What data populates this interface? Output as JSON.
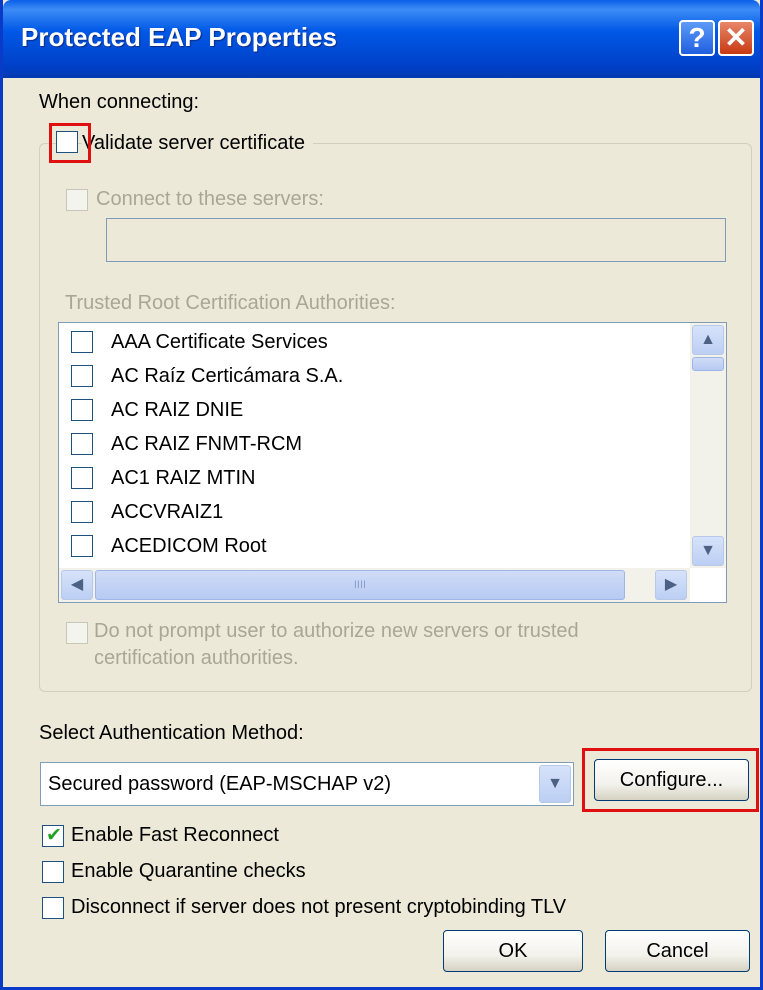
{
  "window": {
    "title": "Protected EAP Properties",
    "help_label": "?",
    "close_label": "✕"
  },
  "when_connecting_label": "When connecting:",
  "validate_cert": {
    "label": "Validate server certificate",
    "checked": false
  },
  "connect_servers": {
    "label": "Connect to these servers:",
    "checked": false,
    "value": ""
  },
  "trusted_root_label": "Trusted Root Certification Authorities:",
  "certificates": [
    "AAA Certificate Services",
    "AC Raíz Certicámara S.A.",
    "AC RAIZ DNIE",
    "AC RAIZ FNMT-RCM",
    "AC1 RAIZ MTIN",
    "ACCVRAIZ1",
    "ACEDICOM Root"
  ],
  "scroll_icons": {
    "up": "▲",
    "down": "▼",
    "left": "◀",
    "right": "▶",
    "grip": "IIII"
  },
  "no_prompt": {
    "label_line1": "Do not prompt user to authorize new servers or trusted",
    "label_line2": "certification authorities.",
    "checked": false
  },
  "auth_method": {
    "label": "Select Authentication Method:",
    "selected": "Secured password (EAP-MSCHAP v2)",
    "dropdown_icon": "▼",
    "configure_label": "Configure..."
  },
  "options": [
    {
      "label": "Enable Fast Reconnect",
      "checked": true
    },
    {
      "label": "Enable Quarantine checks",
      "checked": false
    },
    {
      "label": "Disconnect if server does not present cryptobinding TLV",
      "checked": false
    }
  ],
  "buttons": {
    "ok": "OK",
    "cancel": "Cancel"
  },
  "colors": {
    "titlebar": "#0058e6",
    "highlight": "#e01010",
    "dialog_bg": "#ece9d8"
  }
}
